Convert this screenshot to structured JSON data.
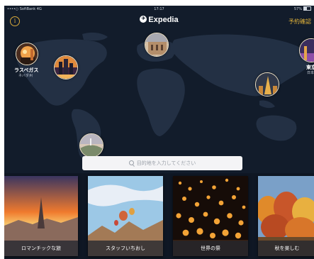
{
  "status_bar": {
    "carrier": "••••○ SoftBank 4G",
    "time": "17:17",
    "battery": "57%"
  },
  "nav": {
    "info_icon": "info-icon",
    "brand": "Expedia",
    "brand_icon": "expedia-globe-icon",
    "reservation": "予約確認"
  },
  "map": {
    "pins": [
      {
        "name": "las-vegas",
        "label": "ラスベガス",
        "sublabel": "ネバダ州"
      },
      {
        "name": "chicago",
        "label": "",
        "sublabel": ""
      },
      {
        "name": "paris",
        "label": "",
        "sublabel": ""
      },
      {
        "name": "tokyo",
        "label": "東京",
        "sublabel": "日本"
      },
      {
        "name": "bangkok",
        "label": "",
        "sublabel": ""
      },
      {
        "name": "rio",
        "label": "",
        "sublabel": ""
      }
    ]
  },
  "search": {
    "placeholder": "目的地を入力してください",
    "icon": "search-icon"
  },
  "cards": [
    {
      "title": "ロマンチックな旅"
    },
    {
      "title": "スタッフいちおし"
    },
    {
      "title": "世界の祭"
    },
    {
      "title": "秋を楽しむ"
    }
  ],
  "colors": {
    "background": "#121c2b",
    "accent": "#e0b23a",
    "search_bg": "#f4f4f6"
  }
}
